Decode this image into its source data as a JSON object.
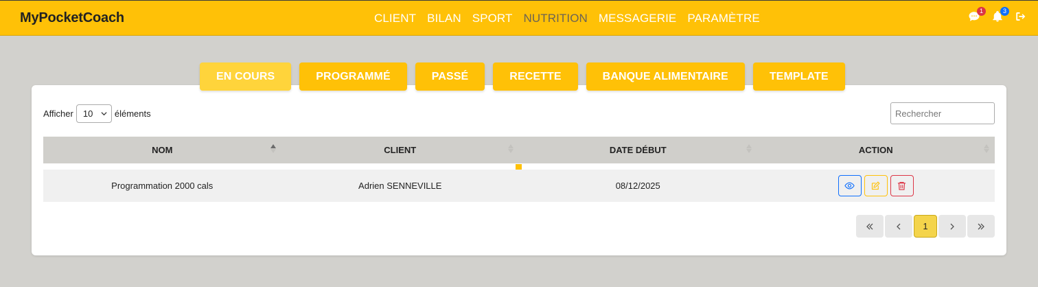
{
  "app": {
    "brand": "MyPocketCoach"
  },
  "nav": {
    "items": [
      {
        "label": "CLIENT",
        "active": false
      },
      {
        "label": "BILAN",
        "active": false
      },
      {
        "label": "SPORT",
        "active": false
      },
      {
        "label": "NUTRITION",
        "active": true
      },
      {
        "label": "MESSAGERIE",
        "active": false
      },
      {
        "label": "PARAMÈTRE",
        "active": false
      }
    ],
    "messages_badge": "1",
    "notifications_badge": "3"
  },
  "tabs": [
    {
      "label": "EN COURS",
      "active": true
    },
    {
      "label": "PROGRAMMÉ",
      "active": false
    },
    {
      "label": "PASSÉ",
      "active": false
    },
    {
      "label": "RECETTE",
      "active": false
    },
    {
      "label": "BANQUE ALIMENTAIRE",
      "active": false
    },
    {
      "label": "TEMPLATE",
      "active": false
    }
  ],
  "table_controls": {
    "show_label": "Afficher",
    "page_length": "10",
    "entries_label": "éléments",
    "search_placeholder": "Rechercher"
  },
  "table": {
    "columns": [
      "NOM",
      "CLIENT",
      "DATE DÉBUT",
      "ACTION"
    ],
    "rows": [
      {
        "nom": "Programmation 2000 cals",
        "client": "Adrien SENNEVILLE",
        "date_debut": "08/12/2025"
      }
    ]
  },
  "pagination": {
    "current_page": "1"
  },
  "colors": {
    "primary": "#ffc107",
    "danger": "#dc3545",
    "info": "#0d6efd",
    "background": "#d2d1cd"
  }
}
